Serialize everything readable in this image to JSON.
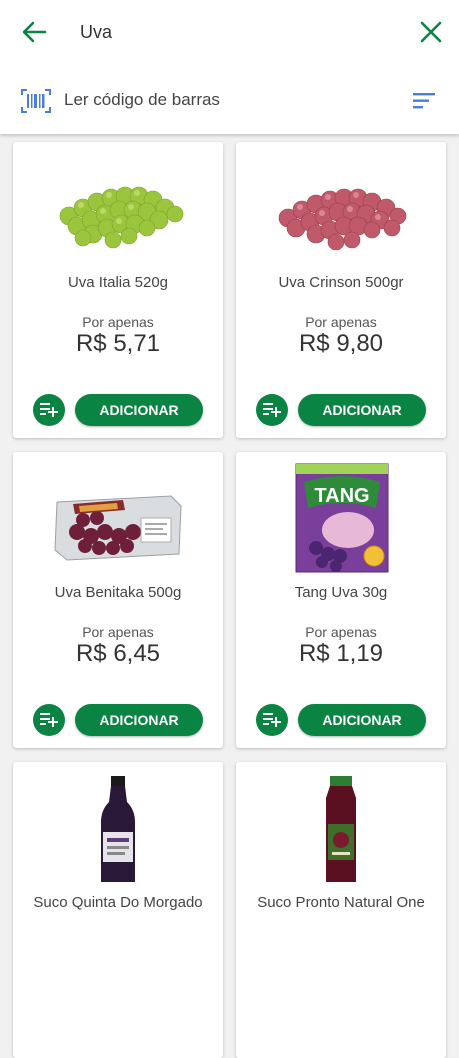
{
  "header": {
    "search_value": "Uva",
    "barcode_label": "Ler código de barras"
  },
  "colors": {
    "brand_green": "#0a8443",
    "barcode_blue": "#4a7fd8"
  },
  "icons": [
    "back-arrow-icon",
    "close-icon",
    "barcode-icon",
    "sort-icon",
    "add-to-list-icon"
  ],
  "products": [
    {
      "name": "Uva Italia 520g",
      "price_label": "Por apenas",
      "price": "R$ 5,71",
      "button": "ADICIONAR"
    },
    {
      "name": "Uva Crinson 500gr",
      "price_label": "Por apenas",
      "price": "R$ 9,80",
      "button": "ADICIONAR"
    },
    {
      "name": "Uva Benitaka 500g",
      "price_label": "Por apenas",
      "price": "R$ 6,45",
      "button": "ADICIONAR"
    },
    {
      "name": "Tang Uva 30g",
      "price_label": "Por apenas",
      "price": "R$ 1,19",
      "button": "ADICIONAR"
    },
    {
      "name": "Suco Quinta Do Morgado"
    },
    {
      "name": "Suco Pronto Natural One"
    }
  ],
  "packaging_text": {
    "tang_logo": "TANG"
  }
}
